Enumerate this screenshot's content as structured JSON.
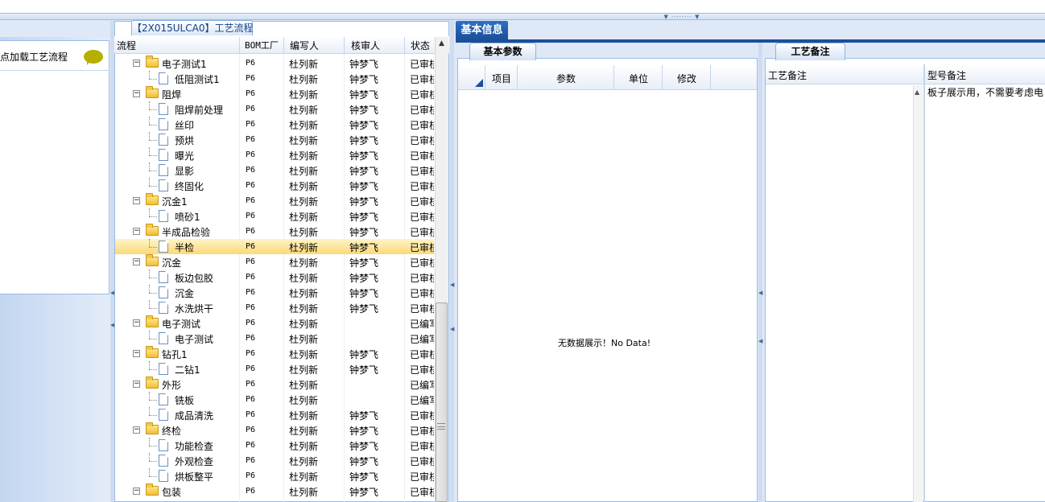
{
  "left_panel": {
    "label": "点加载工艺流程",
    "icon": "speech-bubble-icon"
  },
  "tree": {
    "title": "【2X015ULCA0】工艺流程",
    "columns": [
      "流程",
      "BOM工厂",
      "编写人",
      "核审人",
      "状态"
    ],
    "rows": [
      {
        "name": "电子测试1",
        "type": "folder",
        "level": 0,
        "bom": "P6",
        "writer": "杜列新",
        "reviewer": "钟梦飞",
        "status": "已审核"
      },
      {
        "name": "低阻测试1",
        "type": "doc",
        "level": 1,
        "bom": "P6",
        "writer": "杜列新",
        "reviewer": "钟梦飞",
        "status": "已审核"
      },
      {
        "name": "阻焊",
        "type": "folder",
        "level": 0,
        "bom": "P6",
        "writer": "杜列新",
        "reviewer": "钟梦飞",
        "status": "已审核"
      },
      {
        "name": "阻焊前处理",
        "type": "doc",
        "level": 1,
        "bom": "P6",
        "writer": "杜列新",
        "reviewer": "钟梦飞",
        "status": "已审核"
      },
      {
        "name": "丝印",
        "type": "doc",
        "level": 1,
        "bom": "P6",
        "writer": "杜列新",
        "reviewer": "钟梦飞",
        "status": "已审核"
      },
      {
        "name": "预烘",
        "type": "doc",
        "level": 1,
        "bom": "P6",
        "writer": "杜列新",
        "reviewer": "钟梦飞",
        "status": "已审核"
      },
      {
        "name": "曝光",
        "type": "doc",
        "level": 1,
        "bom": "P6",
        "writer": "杜列新",
        "reviewer": "钟梦飞",
        "status": "已审核"
      },
      {
        "name": "显影",
        "type": "doc",
        "level": 1,
        "bom": "P6",
        "writer": "杜列新",
        "reviewer": "钟梦飞",
        "status": "已审核"
      },
      {
        "name": "终固化",
        "type": "doc",
        "level": 1,
        "bom": "P6",
        "writer": "杜列新",
        "reviewer": "钟梦飞",
        "status": "已审核"
      },
      {
        "name": "沉金1",
        "type": "folder",
        "level": 0,
        "bom": "P6",
        "writer": "杜列新",
        "reviewer": "钟梦飞",
        "status": "已审核"
      },
      {
        "name": "喷砂1",
        "type": "doc",
        "level": 1,
        "bom": "P6",
        "writer": "杜列新",
        "reviewer": "钟梦飞",
        "status": "已审核"
      },
      {
        "name": "半成品检验",
        "type": "folder",
        "level": 0,
        "bom": "P6",
        "writer": "杜列新",
        "reviewer": "钟梦飞",
        "status": "已审核"
      },
      {
        "name": "半检",
        "type": "doc",
        "level": 1,
        "bom": "P6",
        "writer": "杜列新",
        "reviewer": "钟梦飞",
        "status": "已审核",
        "selected": true
      },
      {
        "name": "沉金",
        "type": "folder",
        "level": 0,
        "bom": "P6",
        "writer": "杜列新",
        "reviewer": "钟梦飞",
        "status": "已审核"
      },
      {
        "name": "板边包胶",
        "type": "doc",
        "level": 1,
        "bom": "P6",
        "writer": "杜列新",
        "reviewer": "钟梦飞",
        "status": "已审核"
      },
      {
        "name": "沉金",
        "type": "doc",
        "level": 1,
        "bom": "P6",
        "writer": "杜列新",
        "reviewer": "钟梦飞",
        "status": "已审核"
      },
      {
        "name": "水洗烘干",
        "type": "doc",
        "level": 1,
        "bom": "P6",
        "writer": "杜列新",
        "reviewer": "钟梦飞",
        "status": "已审核"
      },
      {
        "name": "电子测试",
        "type": "folder",
        "level": 0,
        "bom": "P6",
        "writer": "杜列新",
        "reviewer": "",
        "status": "已编写"
      },
      {
        "name": "电子测试",
        "type": "doc",
        "level": 1,
        "bom": "P6",
        "writer": "杜列新",
        "reviewer": "",
        "status": "已编写"
      },
      {
        "name": "钻孔1",
        "type": "folder",
        "level": 0,
        "bom": "P6",
        "writer": "杜列新",
        "reviewer": "钟梦飞",
        "status": "已审核"
      },
      {
        "name": "二钻1",
        "type": "doc",
        "level": 1,
        "bom": "P6",
        "writer": "杜列新",
        "reviewer": "钟梦飞",
        "status": "已审核"
      },
      {
        "name": "外形",
        "type": "folder",
        "level": 0,
        "bom": "P6",
        "writer": "杜列新",
        "reviewer": "",
        "status": "已编写"
      },
      {
        "name": "铣板",
        "type": "doc",
        "level": 1,
        "bom": "P6",
        "writer": "杜列新",
        "reviewer": "",
        "status": "已编写"
      },
      {
        "name": "成品清洗",
        "type": "doc",
        "level": 1,
        "bom": "P6",
        "writer": "杜列新",
        "reviewer": "钟梦飞",
        "status": "已审核"
      },
      {
        "name": "终检",
        "type": "folder",
        "level": 0,
        "bom": "P6",
        "writer": "杜列新",
        "reviewer": "钟梦飞",
        "status": "已审核"
      },
      {
        "name": "功能检查",
        "type": "doc",
        "level": 1,
        "bom": "P6",
        "writer": "杜列新",
        "reviewer": "钟梦飞",
        "status": "已审核"
      },
      {
        "name": "外观检查",
        "type": "doc",
        "level": 1,
        "bom": "P6",
        "writer": "杜列新",
        "reviewer": "钟梦飞",
        "status": "已审核"
      },
      {
        "name": "烘板整平",
        "type": "doc",
        "level": 1,
        "bom": "P6",
        "writer": "杜列新",
        "reviewer": "钟梦飞",
        "status": "已审核"
      },
      {
        "name": "包装",
        "type": "folder",
        "level": 0,
        "bom": "P6",
        "writer": "杜列新",
        "reviewer": "钟梦飞",
        "status": "已审核"
      }
    ]
  },
  "info_panel": {
    "tab_label": "基本信息",
    "params_tab": "基本参数",
    "params_columns": [
      "项目",
      "参数",
      "单位",
      "修改"
    ],
    "no_data": "无数据展示！No Data!",
    "remarks_tab": "工艺备注",
    "remarks_columns": [
      "工艺备注",
      "型号备注"
    ],
    "model_remark": "板子展示用，不需要考虑电"
  },
  "colors": {
    "accent": "#1b4f9a",
    "border": "#99bbe8",
    "selected_row": "#fbd976"
  }
}
